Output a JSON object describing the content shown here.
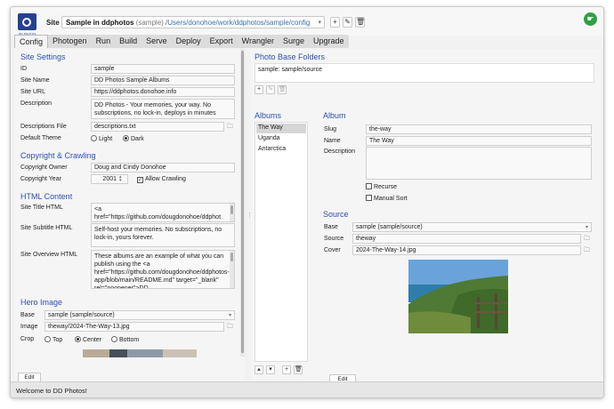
{
  "header": {
    "site_label": "Site",
    "site_name": "Sample in ddphotos",
    "site_id": "(sample)",
    "site_path": "/Users/donohoe/work/ddphotos/sample/config",
    "logo_text": "DD PHOTOS"
  },
  "menu": [
    "Config",
    "Photogen",
    "Run",
    "Build",
    "Serve",
    "Deploy",
    "Export",
    "Wrangler",
    "Surge",
    "Upgrade"
  ],
  "left": {
    "site_settings": {
      "title": "Site Settings",
      "id_label": "ID",
      "id_value": "sample",
      "name_label": "Site Name",
      "name_value": "DD Photos Sample Albums",
      "url_label": "Site URL",
      "url_value": "https://ddphotos.donohoe.info",
      "desc_label": "Description",
      "desc_value": "DD Photos - Your memories, your way. No subscriptions, no lock-in, deploys in minutes",
      "descfile_label": "Descriptions File",
      "descfile_value": "descriptions.txt",
      "theme_label": "Default Theme",
      "theme_light": "Light",
      "theme_dark": "Dark"
    },
    "copyright": {
      "title": "Copyright & Crawling",
      "owner_label": "Copyright Owner",
      "owner_value": "Doug and Cindy Donohoe",
      "year_label": "Copyright Year",
      "year_value": "2001",
      "crawl_label": "Allow Crawling"
    },
    "html": {
      "title": "HTML Content",
      "site_title_label": "Site Title HTML",
      "site_title_value": "<a href=\"https://github.com/dougdonohoe/ddphot",
      "subtitle_label": "Site Subtitle HTML",
      "subtitle_value": "Self-host your memories. No subscriptions, no lock-in, yours forever.",
      "overview_label": "Site Overview HTML",
      "overview_value": "These albums are an example of what you can publish using the <a href=\"https://github.com/dougdonohoe/ddphotos-app/blob/main/README.md\" target=\"_blank\" rel=\"noopener\">DD"
    },
    "hero": {
      "title": "Hero Image",
      "base_label": "Base",
      "base_value": "sample (sample/source)",
      "image_label": "Image",
      "image_value": "theway/2024-The-Way-13.jpg",
      "crop_label": "Crop",
      "crop_top": "Top",
      "crop_center": "Center",
      "crop_bottom": "Bottom"
    },
    "edit_label": "Edit"
  },
  "right": {
    "folders_title": "Photo Base Folders",
    "folder_entry": "sample: sample/source",
    "albums_title": "Albums",
    "albums": [
      "The Way",
      "Uganda",
      "Antarctica"
    ],
    "album_title": "Album",
    "slug_label": "Slug",
    "slug_value": "the-way",
    "name_label": "Name",
    "name_value": "The Way",
    "desc_label": "Description",
    "desc_value": "",
    "recurse_label": "Recurse",
    "manual_sort_label": "Manual Sort",
    "source_title": "Source",
    "base_label": "Base",
    "base_value": "sample (sample/source)",
    "source_label": "Source",
    "source_value": "theway",
    "cover_label": "Cover",
    "cover_value": "2024-The-Way-14.jpg",
    "edit_label": "Edit"
  },
  "status": "Welcome to DD Photos!"
}
